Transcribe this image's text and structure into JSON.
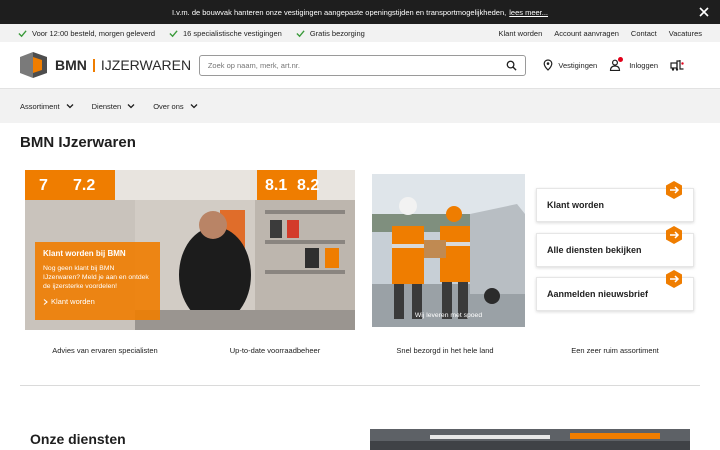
{
  "announcement": {
    "text": "I.v.m. de bouwvak hanteren onze vestigingen aangepaste openingstijden en transportmogelijkheden,",
    "link": "lees meer..."
  },
  "usp": {
    "items": [
      "Voor 12:00 besteld, morgen geleverd",
      "16 specialistische vestigingen",
      "Gratis bezorging"
    ],
    "links": [
      "Klant worden",
      "Account aanvragen",
      "Contact",
      "Vacatures"
    ]
  },
  "brand": {
    "name_bold": "BMN",
    "name_rest": "IJZERWAREN",
    "accent": "#ef7d00"
  },
  "search": {
    "placeholder": "Zoek op naam, merk, art.nr.",
    "value": ""
  },
  "header_actions": {
    "locations": "Vestigingen",
    "login": "Inloggen"
  },
  "nav": {
    "items": [
      "Assortiment",
      "Diensten",
      "Over ons"
    ]
  },
  "page_title": "BMN IJzerwaren",
  "hero": {
    "title": "Klant worden bij BMN",
    "text": "Nog geen klant bij BMN IJzerwaren? Meld je aan en ontdek de ijzersterke voordelen!",
    "link": "Klant worden",
    "sign_numbers": [
      "7",
      "7.2",
      "8.1",
      "8.2"
    ]
  },
  "delivery_caption": "Wij leveren met spoed",
  "cta_cards": [
    "Klant worden",
    "Alle diensten bekijken",
    "Aanmelden nieuwsbrief"
  ],
  "features": [
    "Advies van ervaren specialisten",
    "Up-to-date voorraadbeheer",
    "Snel bezorgd in het hele land",
    "Een zeer ruim assortiment"
  ],
  "section_title": "Onze diensten",
  "icons": [
    "close-icon",
    "check-icon",
    "search-icon",
    "location-pin-icon",
    "user-icon",
    "forklift-icon",
    "chevron-down-icon",
    "chevron-right-icon",
    "arrow-right-icon"
  ]
}
